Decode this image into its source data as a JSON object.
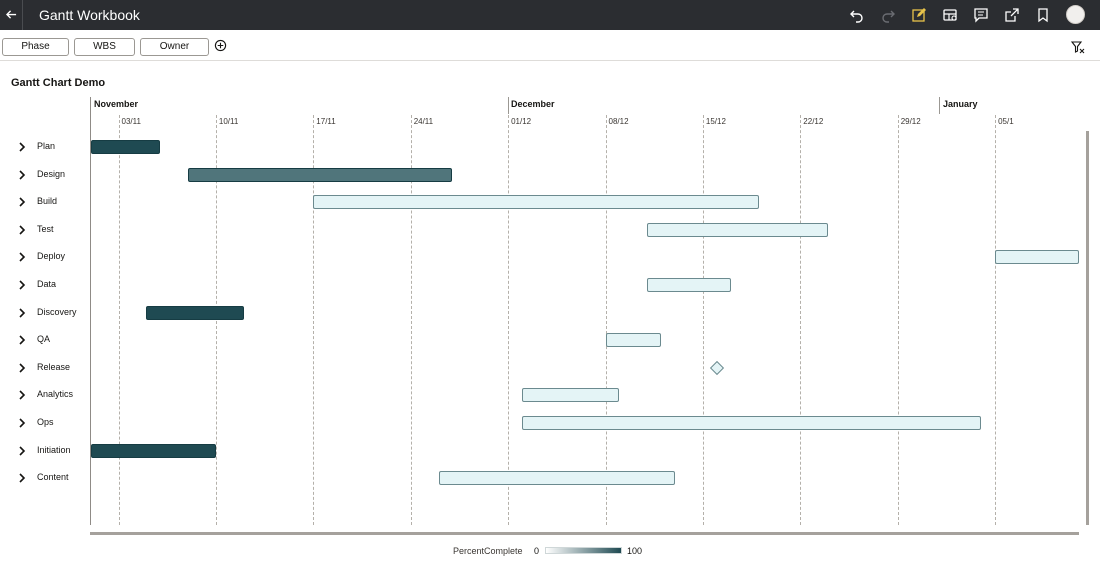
{
  "header": {
    "back_icon": "arrow-left-icon",
    "title": "Gantt Workbook",
    "actions": [
      "undo-icon",
      "redo-icon",
      "edit-icon",
      "data-icon",
      "comment-icon",
      "share-icon",
      "bookmark-icon",
      "avatar"
    ]
  },
  "filters": {
    "chips": [
      "Phase",
      "WBS",
      "Owner"
    ],
    "add_icon": "add-circle-icon",
    "filter_icon": "filter-icon"
  },
  "chart_data": {
    "type": "gantt",
    "title": "Gantt Chart Demo",
    "months": [
      "November",
      "December",
      "January"
    ],
    "ticks": [
      "03/11",
      "10/11",
      "17/11",
      "24/11",
      "01/12",
      "08/12",
      "15/12",
      "22/12",
      "29/12",
      "05/1"
    ],
    "tasks": [
      {
        "label": "Plan",
        "start": "30/10",
        "end": "06/11",
        "percent": 100
      },
      {
        "label": "Design",
        "start": "08/11",
        "end": "27/11",
        "percent": 75
      },
      {
        "label": "Build",
        "start": "17/11",
        "end": "19/12",
        "percent": 0
      },
      {
        "label": "Test",
        "start": "11/12",
        "end": "24/12",
        "percent": 0
      },
      {
        "label": "Deploy",
        "start": "05/01",
        "end": "11/01",
        "percent": 0
      },
      {
        "label": "Data",
        "start": "11/12",
        "end": "17/12",
        "percent": 0
      },
      {
        "label": "Discovery",
        "start": "05/11",
        "end": "12/11",
        "percent": 100
      },
      {
        "label": "QA",
        "start": "08/12",
        "end": "12/12",
        "percent": 0
      },
      {
        "label": "Release",
        "start": "16/12",
        "end": "16/12",
        "percent": 0,
        "milestone": true
      },
      {
        "label": "Analytics",
        "start": "02/12",
        "end": "09/12",
        "percent": 0
      },
      {
        "label": "Ops",
        "start": "02/12",
        "end": "04/01",
        "percent": 0
      },
      {
        "label": "Initiation",
        "start": "01/11",
        "end": "10/11",
        "percent": 100
      },
      {
        "label": "Content",
        "start": "26/11",
        "end": "13/12",
        "percent": 0
      }
    ]
  },
  "legend": {
    "label": "PercentComplete",
    "min": "0",
    "max": "100",
    "colors": {
      "low": "#ffffff",
      "high": "#1f4a52"
    }
  },
  "icons": {
    "row_expand": "chevron-right-icon"
  }
}
